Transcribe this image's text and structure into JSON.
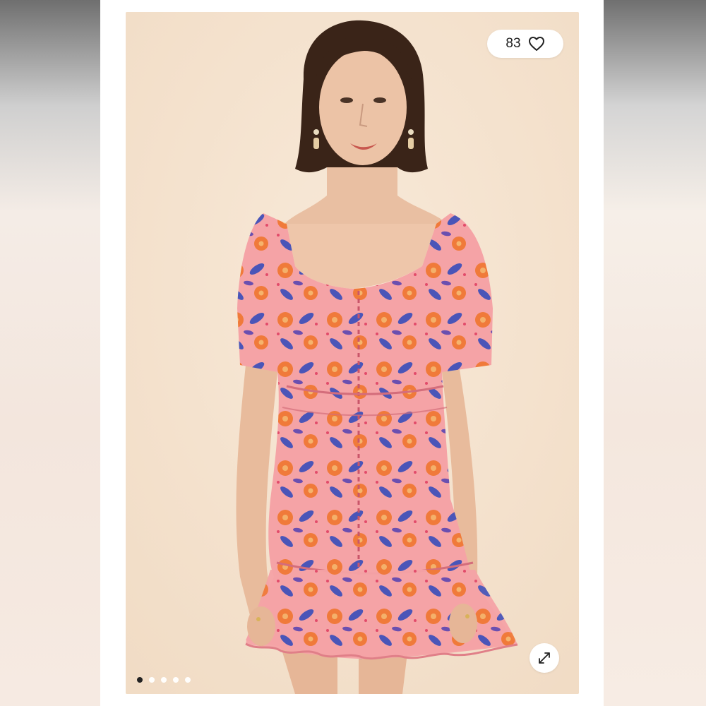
{
  "listing": {
    "likes_count": "83",
    "photo_count": 5,
    "active_photo_index": 0
  },
  "icons": {
    "like": "heart-outline-icon",
    "fullscreen": "expand-arrows-icon"
  },
  "colors": {
    "backdrop": "#f5e3cf",
    "dress_pink": "#f5a4a8",
    "print_orange": "#f07a3a",
    "print_blue": "#4a55b8",
    "hair": "#3a2418",
    "skin": "#e9bfa2"
  }
}
